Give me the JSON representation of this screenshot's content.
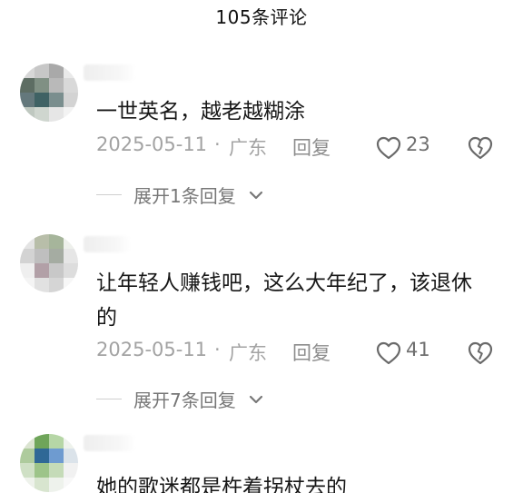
{
  "header": {
    "title": "105条评论"
  },
  "comments": [
    {
      "text": "一世英名，越老越糊涂",
      "date": "2025-05-11",
      "separator": "·",
      "location": "广东",
      "reply_label": "回复",
      "like_count": "23",
      "expand_label": "展开1条回复"
    },
    {
      "text": "让年轻人赚钱吧，这么大年纪了，该退休的",
      "date": "2025-05-11",
      "separator": "·",
      "location": "广东",
      "reply_label": "回复",
      "like_count": "41",
      "expand_label": "展开7条回复"
    },
    {
      "text": "她的歌迷都是杵着拐杖去的"
    }
  ],
  "icons": {
    "like": "heart-outline-icon",
    "dislike": "broken-heart-outline-icon",
    "expand": "chevron-down-icon"
  },
  "colors": {
    "text": "#171717",
    "meta": "#a3a3a3",
    "secondary": "#777777"
  }
}
